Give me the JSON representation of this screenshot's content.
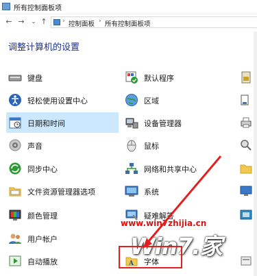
{
  "window": {
    "title": "所有控制面板项"
  },
  "address": {
    "back": "←",
    "forward": "→",
    "dropdown": "⌄",
    "up": "↑",
    "sep1": "›",
    "crumb1": "控制面板",
    "sep2": "›",
    "crumb2": "所有控制面板项"
  },
  "heading": "调整计算机的设置",
  "left_items": [
    {
      "label": "键盘",
      "icon": "keyboard-icon"
    },
    {
      "label": "轻松使用设置中心",
      "icon": "ease-of-access-icon"
    },
    {
      "label": "日期和时间",
      "icon": "date-time-icon"
    },
    {
      "label": "声音",
      "icon": "speaker-icon"
    },
    {
      "label": "同步中心",
      "icon": "sync-icon"
    },
    {
      "label": "文件资源管理器选项",
      "icon": "folder-options-icon"
    },
    {
      "label": "颜色管理",
      "icon": "color-management-icon"
    },
    {
      "label": "用户帐户",
      "icon": "users-icon"
    },
    {
      "label": "自动播放",
      "icon": "autoplay-icon"
    }
  ],
  "mid_items": [
    {
      "label": "默认程序",
      "icon": "default-programs-icon"
    },
    {
      "label": "区域",
      "icon": "region-icon"
    },
    {
      "label": "设备管理器",
      "icon": "device-manager-icon"
    },
    {
      "label": "鼠标",
      "icon": "mouse-icon"
    },
    {
      "label": "网络和共享中心",
      "icon": "network-icon"
    },
    {
      "label": "系统",
      "icon": "system-icon"
    },
    {
      "label": "疑难解答",
      "icon": "troubleshooting-icon"
    },
    {
      "label": "",
      "icon": ""
    },
    {
      "label": "字体",
      "icon": "fonts-icon"
    }
  ],
  "watermark": {
    "url": "www.win7zhijia.cn",
    "logo": "Win7.家"
  },
  "colors": {
    "heading": "#1e3287",
    "selection": "#cce8ff",
    "highlight": "#e02020"
  }
}
